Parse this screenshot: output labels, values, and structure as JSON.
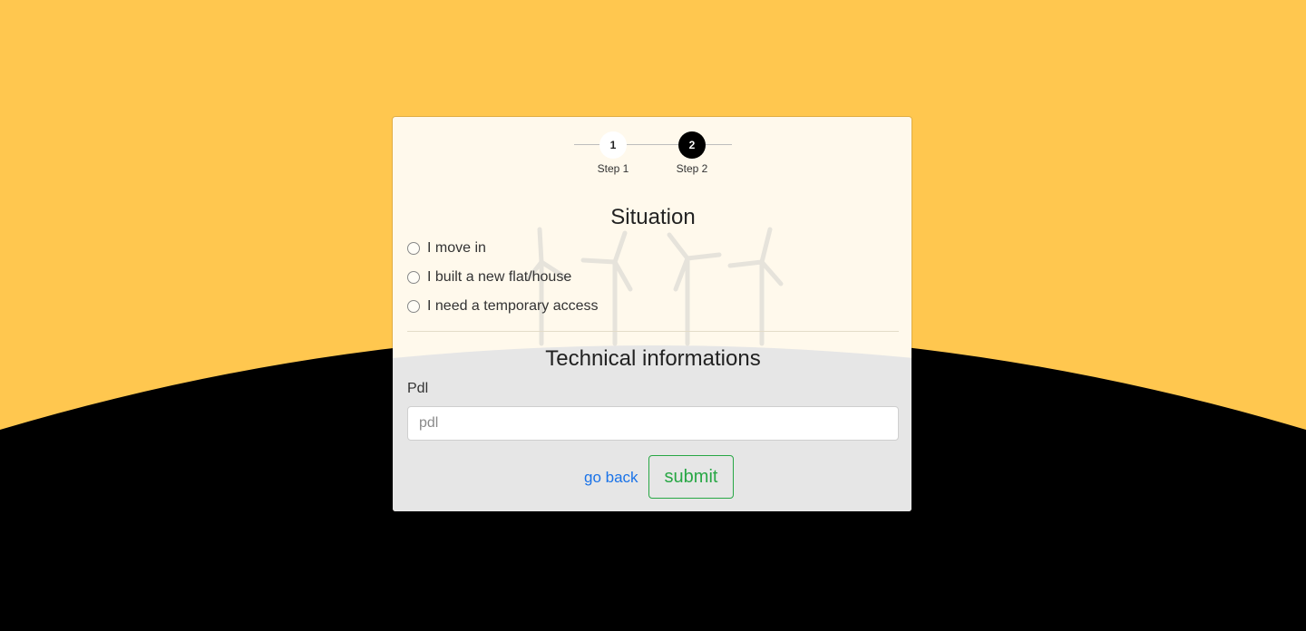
{
  "stepper": {
    "steps": [
      {
        "number": "1",
        "label": "Step 1",
        "state": "done"
      },
      {
        "number": "2",
        "label": "Step 2",
        "state": "active"
      }
    ]
  },
  "situation": {
    "title": "Situation",
    "options": [
      {
        "label": "I move in",
        "checked": false
      },
      {
        "label": "I built a new flat/house",
        "checked": false
      },
      {
        "label": "I need a temporary access",
        "checked": false
      }
    ]
  },
  "technical": {
    "title": "Technical informations",
    "pdl_label": "Pdl",
    "pdl_placeholder": "pdl",
    "pdl_value": ""
  },
  "actions": {
    "back_label": "go back",
    "submit_label": "submit"
  },
  "colors": {
    "sky": "#ffc74f",
    "ground": "#000000",
    "submit": "#28a745",
    "link": "#1a73e8",
    "active_step": "#000000"
  }
}
